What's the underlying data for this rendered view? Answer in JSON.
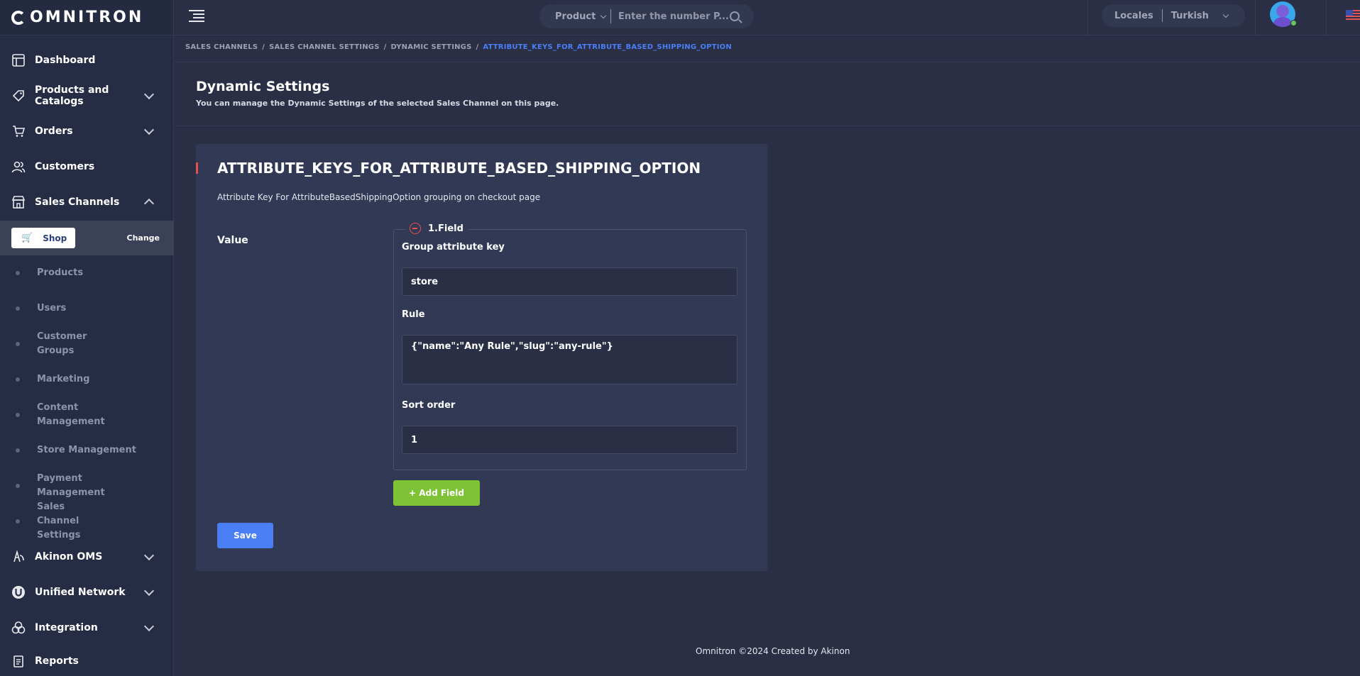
{
  "brand": {
    "name": "OMNITRON"
  },
  "sidebar": {
    "items": [
      {
        "label": "Dashboard",
        "icon": "dashboard-icon"
      },
      {
        "label": "Products and Catalogs",
        "icon": "tag-icon"
      },
      {
        "label": "Orders",
        "icon": "cart-icon"
      },
      {
        "label": "Customers",
        "icon": "users-icon"
      },
      {
        "label": "Sales Channels",
        "icon": "store-icon"
      },
      {
        "label": "Akinon OMS",
        "icon": "oms-icon"
      },
      {
        "label": "Unified Network",
        "icon": "unified-network-icon"
      },
      {
        "label": "Integration",
        "icon": "integration-icon"
      },
      {
        "label": "Reports",
        "icon": "reports-icon"
      }
    ],
    "channel": {
      "name": "Shop",
      "change_label": "Change"
    },
    "subitems": [
      "Products",
      "Users",
      "Customer Groups",
      "Marketing",
      "Content Management",
      "Store Management",
      "Payment Management",
      "Sales Channel Settings"
    ]
  },
  "topbar": {
    "search_type": "Product",
    "search_placeholder": "Enter the number P...",
    "locales_label": "Locales",
    "language": "Turkish"
  },
  "breadcrumb": [
    "SALES CHANNELS",
    "/",
    "SALES CHANNEL SETTINGS",
    "/",
    "DYNAMIC SETTINGS",
    "/",
    "ATTRIBUTE_KEYS_FOR_ATTRIBUTE_BASED_SHIPPING_OPTION"
  ],
  "page": {
    "title": "Dynamic Settings",
    "subtitle": "You can manage the Dynamic Settings of the selected Sales Channel on this page."
  },
  "setting": {
    "key": "ATTRIBUTE_KEYS_FOR_ATTRIBUTE_BASED_SHIPPING_OPTION",
    "description": "Attribute Key For AttributeBasedShippingOption grouping on checkout page",
    "value_label": "Value",
    "field_legend": "1.Field",
    "fields": {
      "group_attribute_key_label": "Group attribute key",
      "group_attribute_key_value": "store",
      "rule_label": "Rule",
      "rule_value": "{\"name\":\"Any Rule\",\"slug\":\"any-rule\"}",
      "sort_order_label": "Sort order",
      "sort_order_value": "1"
    },
    "add_field_label": "+ Add Field",
    "save_label": "Save"
  },
  "footer": {
    "text": "Omnitron ©2024 Created by Akinon"
  },
  "colors": {
    "accent": "#4a7ef5",
    "add": "#7ec236",
    "danger": "#e85050",
    "sidebar_bg": "#262c43",
    "page_bg": "#2a2f45"
  }
}
